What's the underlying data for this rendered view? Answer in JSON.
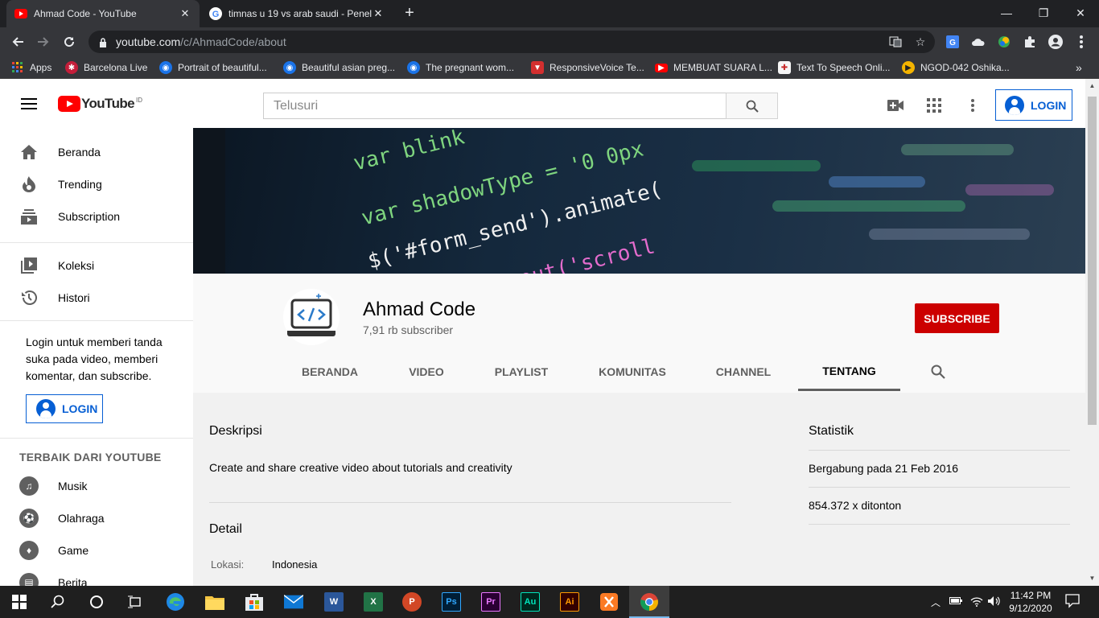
{
  "browser": {
    "tabs": [
      {
        "title": "Ahmad Code - YouTube",
        "active": true
      },
      {
        "title": "timnas u 19 vs arab saudi - Penel",
        "active": false
      }
    ],
    "url_host": "youtube.com",
    "url_path": "/c/AhmadCode/about",
    "bookmarks": [
      {
        "label": "Apps",
        "icon": "apps-grid-icon"
      },
      {
        "label": "Barcelona Live",
        "icon": "barcelona-icon"
      },
      {
        "label": "Portrait of beautiful...",
        "icon": "globe-icon"
      },
      {
        "label": "Beautiful asian preg...",
        "icon": "globe-icon"
      },
      {
        "label": "The pregnant wom...",
        "icon": "globe-icon"
      },
      {
        "label": "ResponsiveVoice Te...",
        "icon": "shield-icon"
      },
      {
        "label": "MEMBUAT SUARA L...",
        "icon": "youtube-icon"
      },
      {
        "label": "Text To Speech Onli...",
        "icon": "tts-icon"
      },
      {
        "label": "NGOD-042 Oshika...",
        "icon": "play-circle-icon"
      }
    ],
    "colors": {
      "tab_bg": "#202124",
      "toolbar": "#35363a"
    }
  },
  "youtube": {
    "logo_word": "YouTube",
    "logo_country": "ID",
    "search_placeholder": "Telusuri",
    "login_label": "LOGIN",
    "sidebar": {
      "main": [
        {
          "label": "Beranda",
          "icon": "home-icon"
        },
        {
          "label": "Trending",
          "icon": "flame-icon"
        },
        {
          "label": "Subscription",
          "icon": "subscriptions-icon"
        }
      ],
      "library": [
        {
          "label": "Koleksi",
          "icon": "library-icon"
        },
        {
          "label": "Histori",
          "icon": "history-icon"
        }
      ],
      "prompt": "Login untuk memberi tanda suka pada video, memberi komentar, dan subscribe.",
      "login_label": "LOGIN",
      "best_heading": "TERBAIK DARI YOUTUBE",
      "best": [
        {
          "label": "Musik",
          "icon": "music-icon"
        },
        {
          "label": "Olahraga",
          "icon": "sports-icon"
        },
        {
          "label": "Game",
          "icon": "game-icon"
        },
        {
          "label": "Berita",
          "icon": "news-icon"
        }
      ]
    },
    "banner_code": [
      "var blink",
      "var shadowType = '0 0px",
      "$('#form_send').animate(",
      "setTimeout('scroll"
    ],
    "channel": {
      "name": "Ahmad Code",
      "subscribers": "7,91 rb subscriber",
      "subscribe_label": "SUBSCRIBE",
      "tabs": [
        "BERANDA",
        "VIDEO",
        "PLAYLIST",
        "KOMUNITAS",
        "CHANNEL",
        "TENTANG"
      ],
      "selected_tab": "TENTANG"
    },
    "about": {
      "description_heading": "Deskripsi",
      "description": "Create and share creative video about tutorials and creativity",
      "details_heading": "Detail",
      "location_label": "Lokasi:",
      "location_value": "Indonesia",
      "stats_heading": "Statistik",
      "joined": "Bergabung pada 21 Feb 2016",
      "views": "854.372 x ditonton"
    },
    "colors": {
      "subscribe": "#cc0000",
      "login_blue": "#065fd4"
    }
  },
  "taskbar": {
    "apps": [
      "windows-start-icon",
      "search-icon",
      "cortana-icon",
      "task-view-icon",
      "edge-icon",
      "file-explorer-icon",
      "store-icon",
      "mail-icon",
      "word-icon",
      "excel-icon",
      "powerpoint-icon",
      "photoshop-icon",
      "premiere-icon",
      "audition-icon",
      "illustrator-icon",
      "xampp-icon",
      "chrome-icon"
    ],
    "labels": {
      "word": "W",
      "excel": "X",
      "powerpoint": "P",
      "photoshop": "Ps",
      "premiere": "Pr",
      "audition": "Au",
      "illustrator": "Ai"
    },
    "time": "11:42 PM",
    "date": "9/12/2020"
  }
}
